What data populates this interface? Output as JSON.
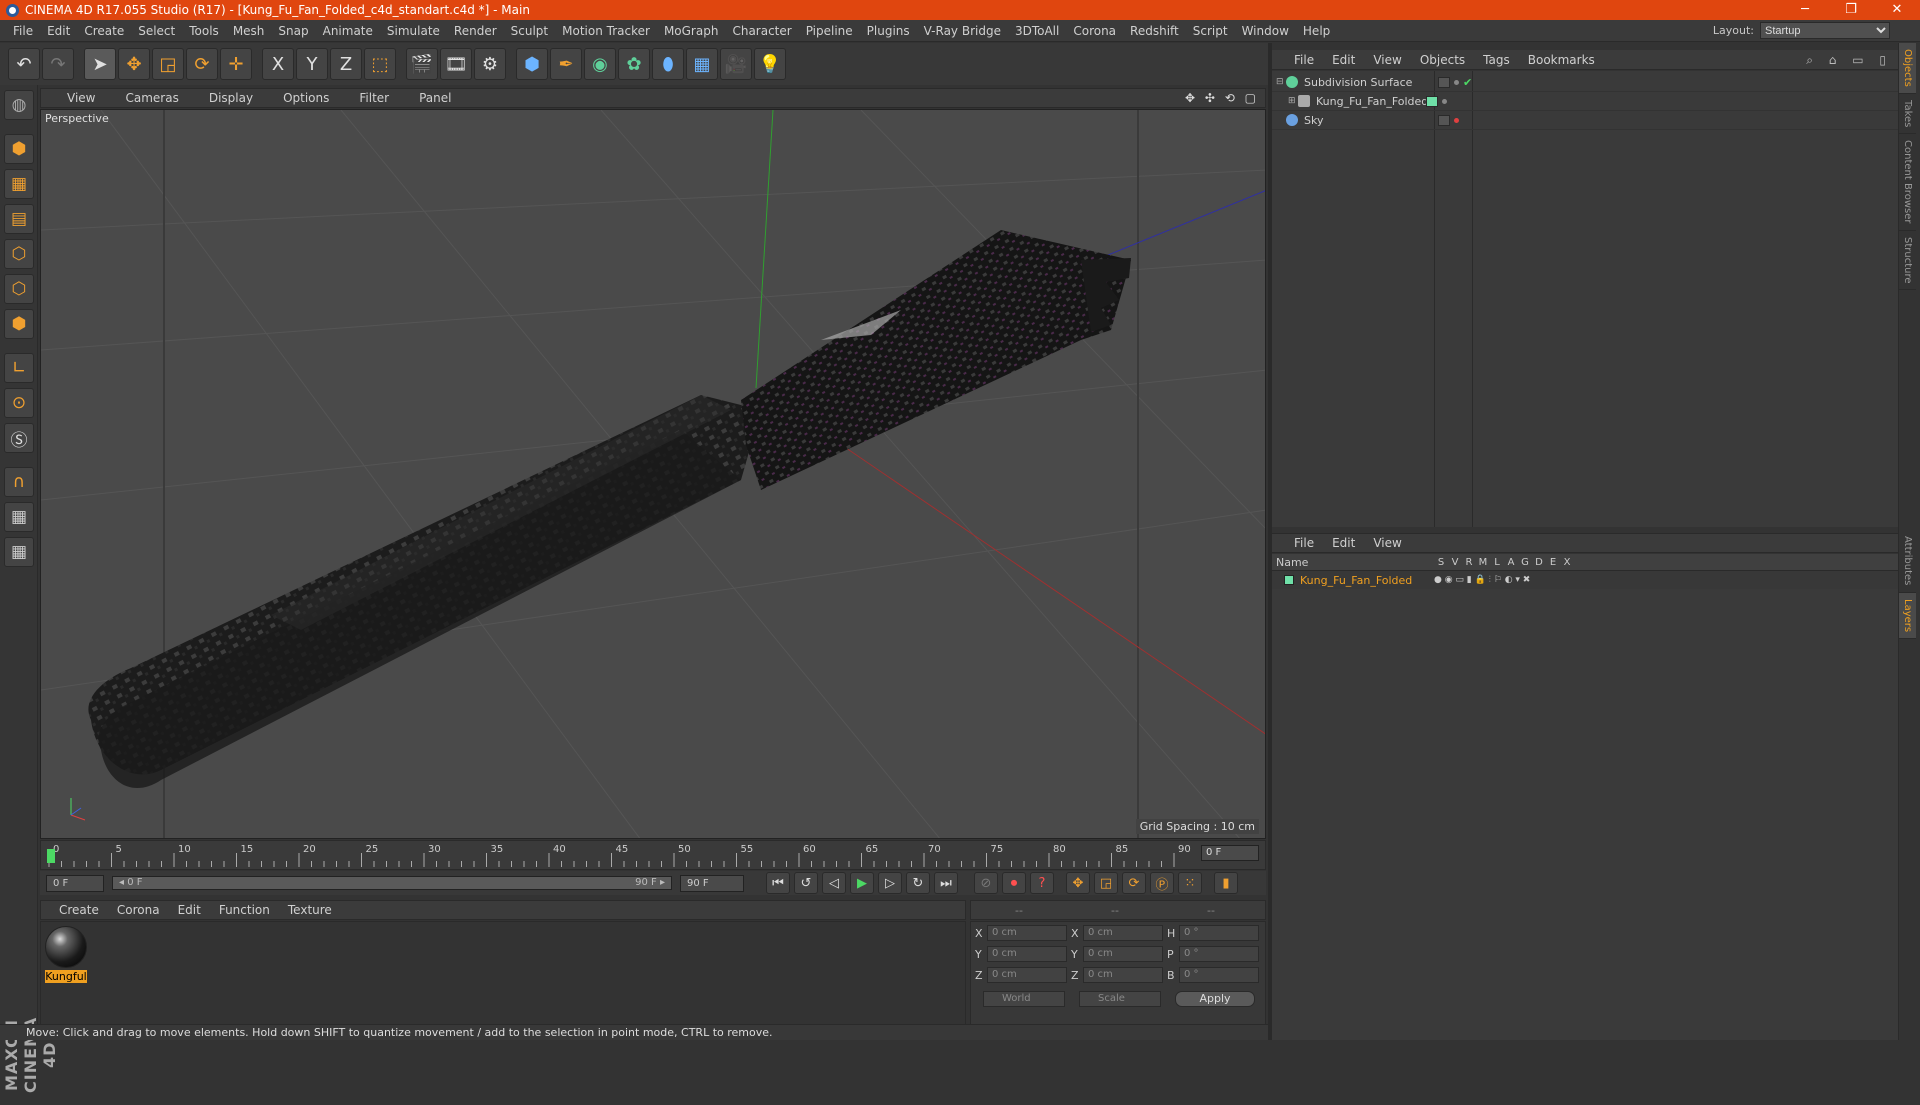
{
  "window": {
    "title": "CINEMA 4D R17.055 Studio (R17) - [Kung_Fu_Fan_Folded_c4d_standart.c4d *] - Main",
    "min": "─",
    "max": "❐",
    "close": "✕"
  },
  "menu": {
    "items": [
      "File",
      "Edit",
      "Create",
      "Select",
      "Tools",
      "Mesh",
      "Snap",
      "Animate",
      "Simulate",
      "Render",
      "Sculpt",
      "Motion Tracker",
      "MoGraph",
      "Character",
      "Pipeline",
      "Plugins",
      "V-Ray Bridge",
      "3DToAll",
      "Corona",
      "Redshift",
      "Script",
      "Window",
      "Help"
    ],
    "layout_label": "Layout:",
    "layout_value": "Startup"
  },
  "toolbar": {
    "icons": [
      "undo-icon",
      "redo-icon",
      "select-arrow-icon",
      "move-icon",
      "scale-icon",
      "rotate-icon",
      "transform-icon",
      "x-axis-icon",
      "y-axis-icon",
      "z-axis-icon",
      "coordinate-system-icon",
      "render-view-icon",
      "render-picture-viewer-icon",
      "render-settings-icon",
      "cube-icon",
      "pen-spline-icon",
      "subdivision-icon",
      "array-icon",
      "deformer-icon",
      "floor-icon",
      "camera-icon",
      "light-icon"
    ],
    "x_label": "X",
    "y_label": "Y",
    "z_label": "Z"
  },
  "viewport": {
    "menu": [
      "View",
      "Cameras",
      "Display",
      "Options",
      "Filter",
      "Panel"
    ],
    "label": "Perspective",
    "grid_spacing": "Grid Spacing : 10 cm",
    "nav_icons": "✥ ✣ ⟲ ▢"
  },
  "timeline": {
    "ticks": [
      "0",
      "5",
      "10",
      "15",
      "20",
      "25",
      "30",
      "35",
      "40",
      "45",
      "50",
      "55",
      "60",
      "65",
      "70",
      "75",
      "80",
      "85",
      "90"
    ],
    "current_frame": "0 F"
  },
  "animation": {
    "start_field": "0 F",
    "range_start": "◂ 0 F",
    "range_end": "90 F ▸",
    "end_field": "90 F"
  },
  "material": {
    "menu": [
      "Create",
      "Corona",
      "Edit",
      "Function",
      "Texture"
    ],
    "items": [
      {
        "name": "Kungful"
      }
    ]
  },
  "coordinates": {
    "header": [
      "--",
      "--",
      "--"
    ],
    "rows": [
      {
        "l1": "X",
        "v1": "0 cm",
        "l2": "X",
        "v2": "0 cm",
        "l3": "H",
        "v3": "0 °"
      },
      {
        "l1": "Y",
        "v1": "0 cm",
        "l2": "Y",
        "v2": "0 cm",
        "l3": "P",
        "v3": "0 °"
      },
      {
        "l1": "Z",
        "v1": "0 cm",
        "l2": "Z",
        "v2": "0 cm",
        "l3": "B",
        "v3": "0 °"
      }
    ],
    "world": "World",
    "scale": "Scale",
    "apply": "Apply"
  },
  "status": "Move: Click and drag to move elements. Hold down SHIFT to quantize movement / add to the selection in point mode, CTRL to remove.",
  "objects": {
    "menu": [
      "File",
      "Edit",
      "View",
      "Objects",
      "Tags",
      "Bookmarks"
    ],
    "items": [
      {
        "name": "Subdivision Surface",
        "color": "#5fd09a"
      },
      {
        "name": "Kung_Fu_Fan_Folded",
        "color": "#aaa"
      },
      {
        "name": "Sky",
        "color": "#6aa0e0"
      }
    ]
  },
  "layers": {
    "menu": [
      "File",
      "Edit",
      "View"
    ],
    "columns": [
      "Name",
      "S",
      "V",
      "R",
      "M",
      "L",
      "A",
      "G",
      "D",
      "E",
      "X"
    ],
    "items": [
      {
        "name": "Kung_Fu_Fan_Folded",
        "color": "#6fe0a8"
      }
    ]
  },
  "side_tabs": [
    "Objects",
    "Takes",
    "Content Browser",
    "Structure",
    "Attributes",
    "Layers"
  ],
  "maxon_logo": "MAXON CINEMA 4D"
}
